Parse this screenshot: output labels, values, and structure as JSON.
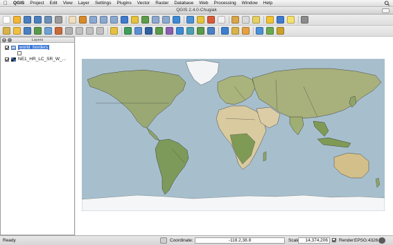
{
  "menubar": {
    "app_name": "QGIS",
    "items": [
      "Project",
      "Edit",
      "View",
      "Layer",
      "Settings",
      "Plugins",
      "Vector",
      "Raster",
      "Database",
      "Web",
      "Processing",
      "Window",
      "Help"
    ]
  },
  "window": {
    "title": "QGIS 2.4.0-Chugiak"
  },
  "toolbar_top": {
    "icons": [
      "new-project-icon",
      "open-project-icon",
      "save-project-icon",
      "save-as-icon",
      "print-composer-icon",
      "composer-manager-icon",
      "pan-icon",
      "pan-to-selection-icon",
      "zoom-in-icon",
      "zoom-out-icon",
      "zoom-actual-icon",
      "zoom-full-icon",
      "zoom-to-selection-icon",
      "zoom-to-layer-icon",
      "zoom-last-icon",
      "zoom-next-icon",
      "refresh-icon",
      "identify-icon",
      "select-features-icon",
      "deselect-icon",
      "open-attribute-table-icon",
      "field-calculator-icon",
      "measure-icon",
      "map-tips-icon",
      "new-bookmark-icon",
      "show-bookmarks-icon",
      "text-annotation-icon",
      "help-icon"
    ],
    "colors": [
      "#ffffff",
      "#f2b632",
      "#4a7fc1",
      "#4a7fc1",
      "#6a8fb8",
      "#9a9a9a",
      "#f0e0c0",
      "#d88a2a",
      "#8aa8d0",
      "#8aa8d0",
      "#8aa8d0",
      "#3f7bcf",
      "#e6c23b",
      "#5c9c4a",
      "#8aa8d0",
      "#8aa8d0",
      "#3b8ad6",
      "#4a90d6",
      "#e6c23b",
      "#d85a3a",
      "#f0f0f0",
      "#d9a548",
      "#dadada",
      "#e8d060",
      "#f2c230",
      "#3f7bcf",
      "#f6e16b",
      "#8c8c8c"
    ]
  },
  "toolbar_bottom": {
    "icons": [
      "toggle-editing-icon",
      "current-edits-icon",
      "save-edits-icon",
      "add-feature-icon",
      "move-feature-icon",
      "node-tool-icon",
      "delete-selected-icon",
      "cut-features-icon",
      "copy-features-icon",
      "paste-features-icon",
      "label-icon",
      "add-vector-layer-icon",
      "add-raster-layer-icon",
      "add-postgis-icon",
      "add-spatialite-icon",
      "add-mssql-icon",
      "add-wms-icon",
      "add-wcs-icon",
      "add-wfs-icon",
      "new-shapefile-icon",
      "digitize-icon",
      "rotate-label-icon",
      "change-label-icon",
      "plugin-icon",
      "grass-icon",
      "python-icon"
    ],
    "colors": [
      "#d9b34a",
      "#f0c040",
      "#4a7fc1",
      "#5a9a4a",
      "#6fa1d4",
      "#c96a3a",
      "#b0b0b0",
      "#c0c0c0",
      "#c0c0c0",
      "#c0c0c0",
      "#e8c040",
      "#3f9d5c",
      "#5a8fd4",
      "#3060a0",
      "#5a9a4a",
      "#8a5fb0",
      "#3b8ad6",
      "#4aa0b0",
      "#5a9a4a",
      "#4a7fc1",
      "#3b7fcf",
      "#d9b34a",
      "#e6a040",
      "#4a90d6",
      "#6aa84f",
      "#c9a22a"
    ]
  },
  "layers_panel": {
    "title": "Layers",
    "layers": [
      {
        "name": "world_borders",
        "checked": true,
        "selected": true
      },
      {
        "name": "NE1_HR_LC_SR_W_...",
        "checked": true,
        "selected": false
      }
    ]
  },
  "status": {
    "ready": "Ready",
    "coordinate_label": "Coordinate:",
    "coordinate_value": "-118.2,38.8",
    "scale_label": "Scale",
    "scale_value": "14,374,206",
    "render_label": "Render",
    "crs": "EPSG:4326"
  },
  "colors": {
    "ocean": "#a7bfcd",
    "land": "#9cab78",
    "desert": "#d9caa0",
    "ice": "#f4f6f7",
    "borders": "#2a2a2a",
    "selection": "#3875d7"
  }
}
